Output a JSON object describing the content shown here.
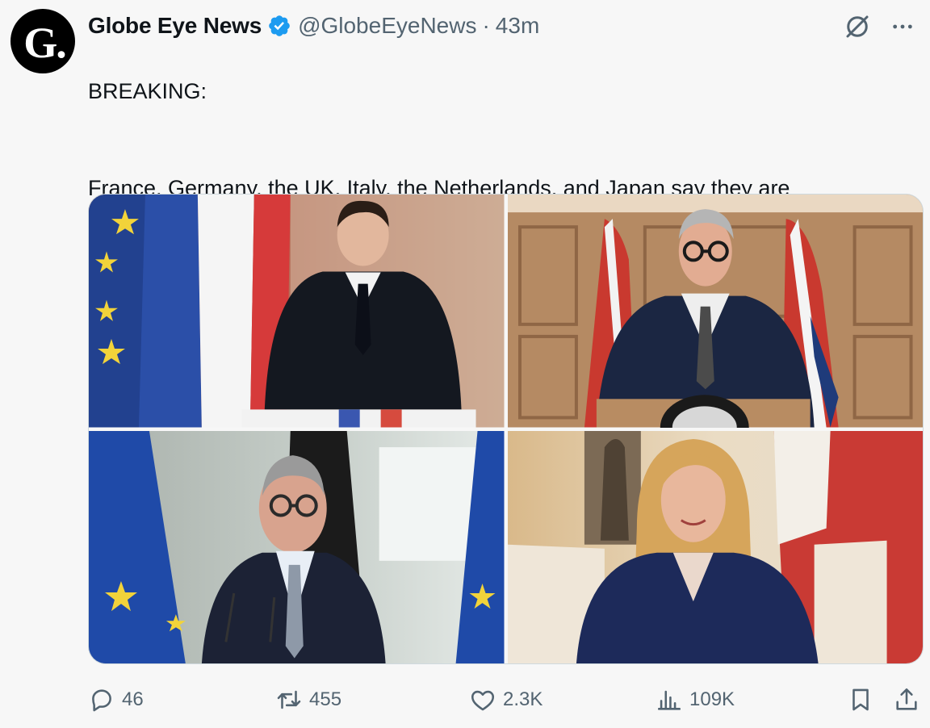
{
  "author": {
    "display_name": "Globe Eye News",
    "handle": "@GlobeEyeNews",
    "separator": "·",
    "timestamp": "43m",
    "avatar_text": "G.",
    "verified": true
  },
  "tweet": {
    "line1": "BREAKING:",
    "line2": "France, Germany, the UK, Italy, the Netherlands, and Japan say they are\nready to join efforts to ensure safe passage through the Strait of Hormuz."
  },
  "media": [
    {
      "name": "photo-france",
      "description_icon": "photo"
    },
    {
      "name": "photo-uk",
      "description_icon": "photo"
    },
    {
      "name": "photo-germany",
      "description_icon": "photo"
    },
    {
      "name": "photo-italy",
      "description_icon": "photo"
    }
  ],
  "actions": {
    "replies": "46",
    "reposts": "455",
    "likes": "2.3K",
    "views": "109K"
  },
  "colors": {
    "accent_verified": "#1d9bf0",
    "muted_text": "#536471",
    "background": "#f7f7f7"
  },
  "icons": [
    "verified-badge-icon",
    "grok-icon",
    "more-icon",
    "reply-icon",
    "repost-icon",
    "like-icon",
    "views-icon",
    "bookmark-icon",
    "share-icon"
  ]
}
